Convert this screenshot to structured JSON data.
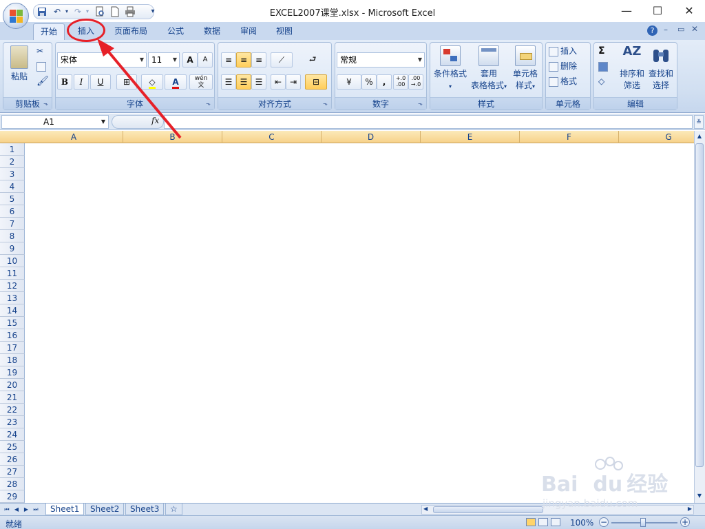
{
  "window": {
    "title": "EXCEL2007课堂.xlsx - Microsoft Excel",
    "minimize_icon": "minimize-icon",
    "maximize_icon": "maximize-icon",
    "close_icon": "close-icon"
  },
  "qat": {
    "items": [
      "save-icon",
      "undo-icon",
      "redo-icon",
      "print-preview-icon",
      "new-icon",
      "quick-print-icon"
    ],
    "customize": "▾"
  },
  "tabs": [
    {
      "label": "开始",
      "active": true
    },
    {
      "label": "插入",
      "active": false
    },
    {
      "label": "页面布局",
      "active": false
    },
    {
      "label": "公式",
      "active": false
    },
    {
      "label": "数据",
      "active": false
    },
    {
      "label": "审阅",
      "active": false
    },
    {
      "label": "视图",
      "active": false
    }
  ],
  "ribbon": {
    "clipboard": {
      "label": "剪贴板",
      "paste": "粘贴"
    },
    "font": {
      "label": "字体",
      "name": "宋体",
      "size": "11",
      "bold": "B",
      "italic": "I",
      "underline": "U",
      "grow": "A",
      "shrink": "A",
      "pinyin": "wén",
      "pinyin_char": "文",
      "font_color_letter": "A"
    },
    "alignment": {
      "label": "对齐方式"
    },
    "number": {
      "label": "数字",
      "format": "常规",
      "percent": "%",
      "comma": ",",
      "inc_decimal": "+.0",
      "inc_decimal2": ".00",
      "dec_decimal": ".00",
      "dec_decimal2": "→.0"
    },
    "styles": {
      "label": "样式",
      "conditional": "条件格式",
      "table_line1": "套用",
      "table_line2": "表格格式",
      "cell_line1": "单元格",
      "cell_line2": "样式"
    },
    "cells": {
      "label": "单元格",
      "insert": "插入",
      "delete": "删除",
      "format": "格式"
    },
    "editing": {
      "label": "编辑",
      "sum": "Σ",
      "sort_line1": "排序和",
      "sort_line2": "筛选",
      "find_line1": "查找和",
      "find_line2": "选择"
    }
  },
  "formula_bar": {
    "name_box": "A1",
    "fx": "fx",
    "content": ""
  },
  "columns": [
    "A",
    "B",
    "C",
    "D",
    "E",
    "F",
    "G"
  ],
  "rows": [
    "1",
    "2",
    "3",
    "4",
    "5",
    "6",
    "7",
    "8",
    "9",
    "10",
    "11",
    "12",
    "13",
    "14",
    "15",
    "16",
    "17",
    "18",
    "19",
    "20",
    "21",
    "22",
    "23",
    "24",
    "25",
    "26",
    "27",
    "28",
    "29"
  ],
  "sheets": [
    {
      "label": "Sheet1",
      "active": true
    },
    {
      "label": "Sheet2",
      "active": false
    },
    {
      "label": "Sheet3",
      "active": false
    }
  ],
  "status": {
    "text": "就绪",
    "zoom": "100%",
    "zoom_minus": "−",
    "zoom_plus": "+"
  },
  "watermark": {
    "brand": "Bai",
    "brand2": "du",
    "cn": "经验",
    "url": "jingyan.baidu.com"
  },
  "colors": {
    "accent_red": "#e62028",
    "header_orange": "#f7d28a",
    "ribbon_blue": "#dbe6f4"
  }
}
